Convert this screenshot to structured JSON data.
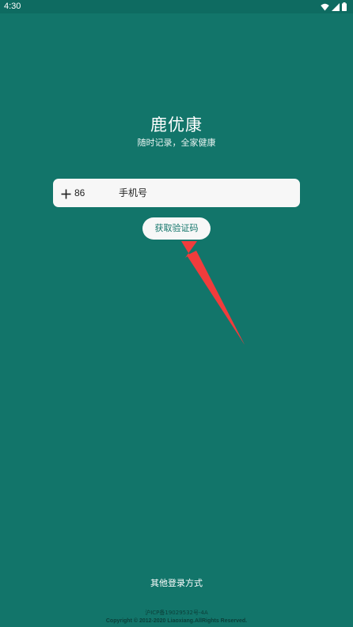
{
  "status_bar": {
    "time": "4:30",
    "icons": [
      "wifi-icon",
      "signal-icon",
      "battery-icon"
    ]
  },
  "app": {
    "title": "鹿优康",
    "subtitle": "随时记录，全家健康"
  },
  "login_form": {
    "country_code": "86",
    "phone_placeholder": "手机号",
    "get_code_label": "获取验证码"
  },
  "footer": {
    "other_login": "其他登录方式",
    "icp": "沪ICP备19029532号-4A",
    "copyright": "Copyright © 2012-2020 Liaoxiang.AllRights Reserved."
  },
  "colors": {
    "background": "#12756a",
    "status_bar": "#0e6b61",
    "input_bg": "#f7f7f7",
    "annotation_arrow": "#f03c3c"
  }
}
